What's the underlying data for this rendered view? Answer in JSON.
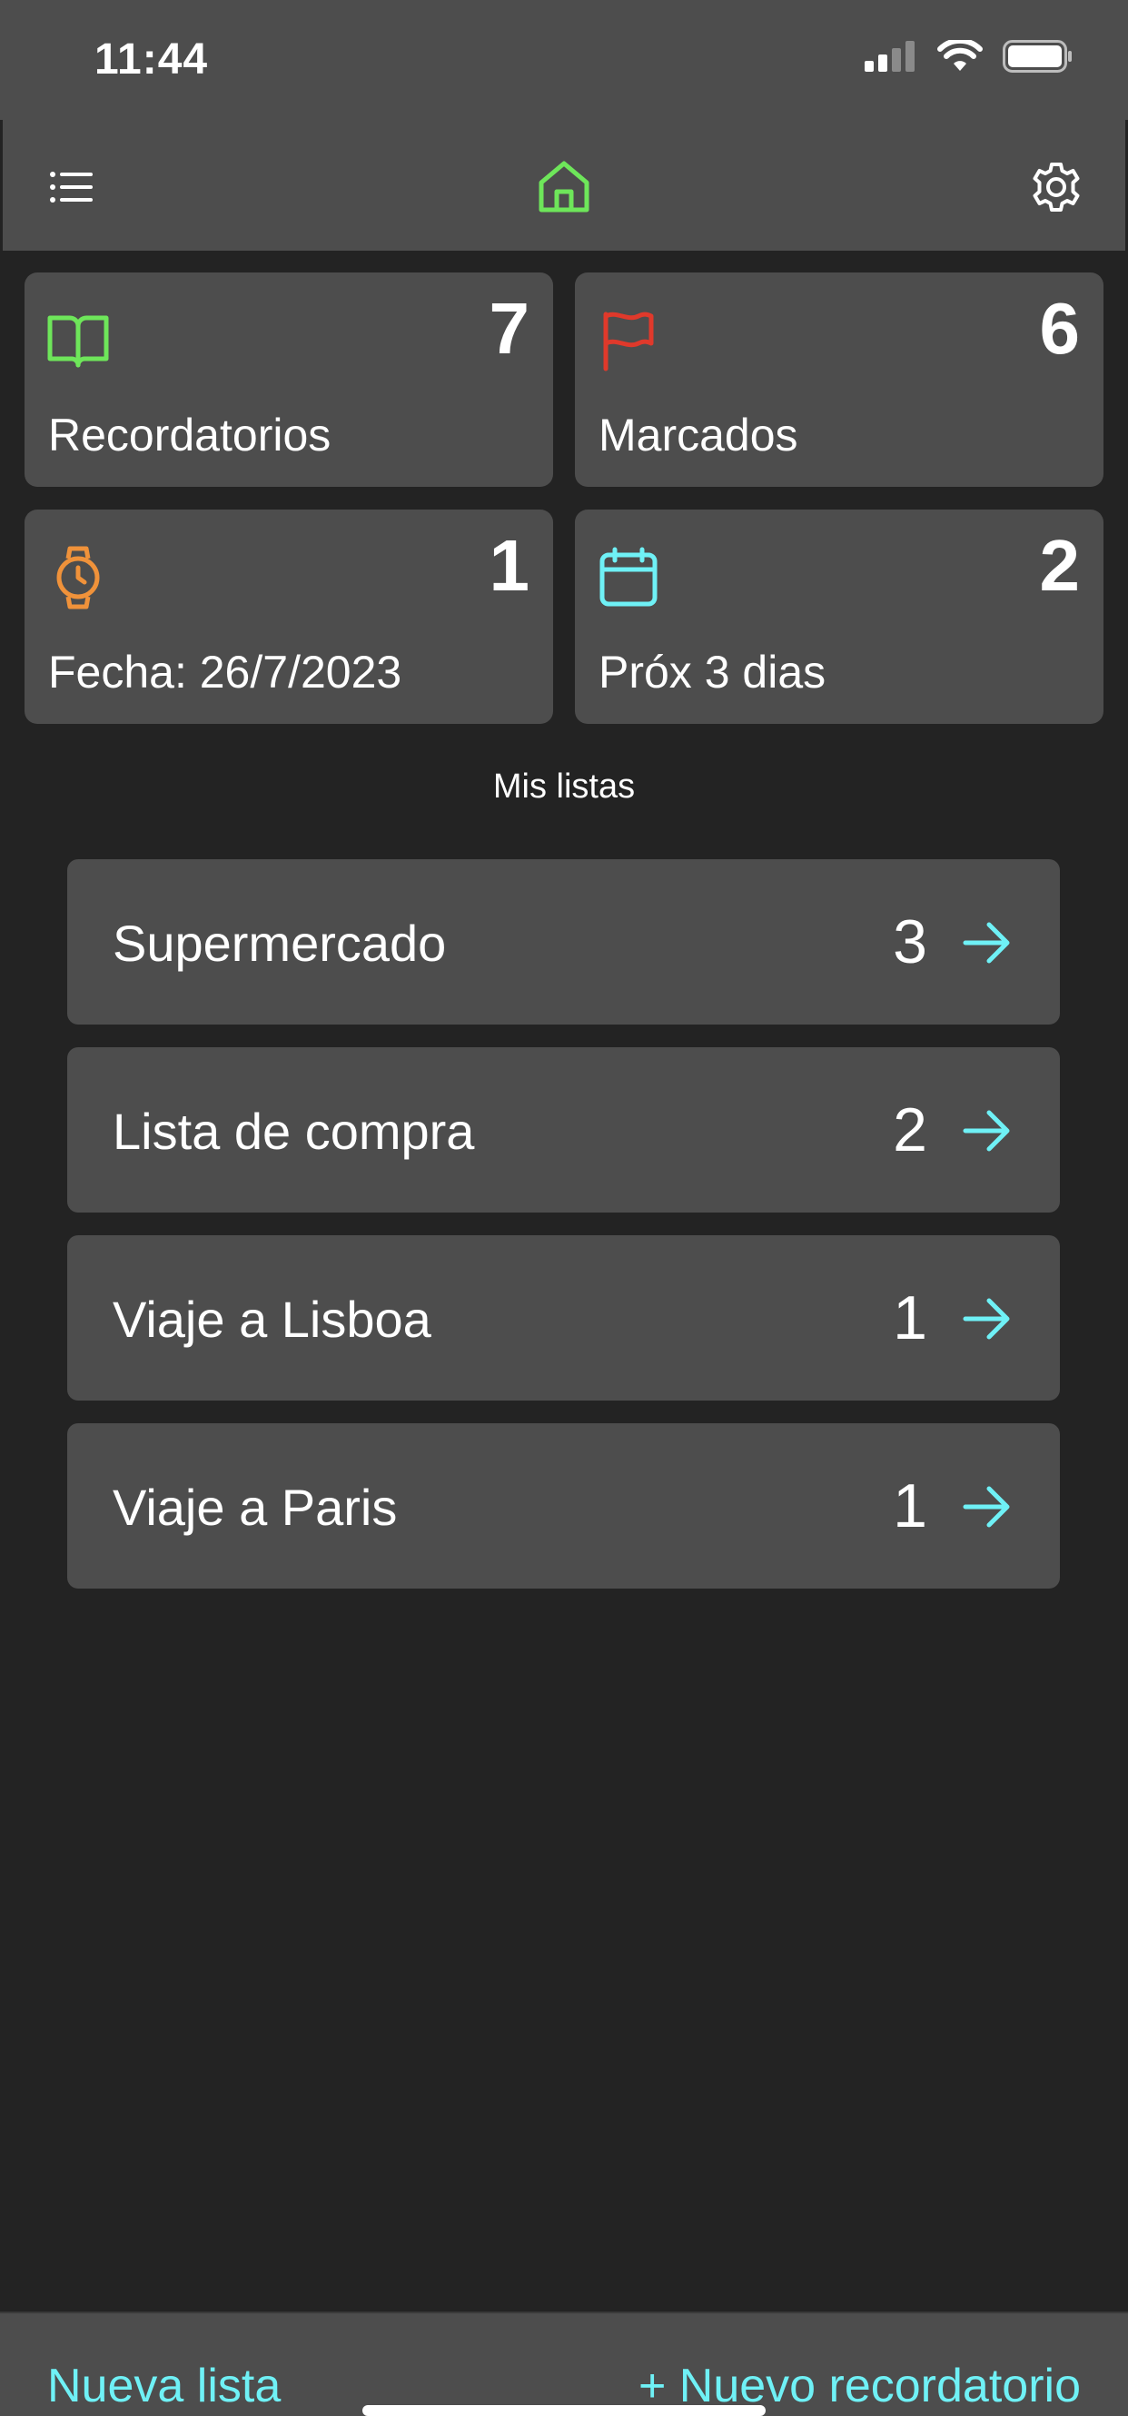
{
  "status": {
    "time": "11:44"
  },
  "nav": {
    "menu_icon": "list-icon",
    "home_icon": "home-icon",
    "settings_icon": "gear-icon"
  },
  "cards": [
    {
      "icon": "book-icon",
      "count": "7",
      "label": "Recordatorios",
      "color": "#6ee65a"
    },
    {
      "icon": "flag-icon",
      "count": "6",
      "label": "Marcados",
      "color": "#e0392b"
    },
    {
      "icon": "watch-icon",
      "count": "1",
      "label": "Fecha: 26/7/2023",
      "color": "#f0923a"
    },
    {
      "icon": "calendar-icon",
      "count": "2",
      "label": "Próx 3 dias",
      "color": "#6ff1f6"
    }
  ],
  "section_title": "Mis listas",
  "lists": [
    {
      "name": "Supermercado",
      "count": "3"
    },
    {
      "name": "Lista de compra",
      "count": "2"
    },
    {
      "name": "Viaje a Lisboa",
      "count": "1"
    },
    {
      "name": "Viaje a Paris",
      "count": "1"
    }
  ],
  "bottom": {
    "new_list": "Nueva lista",
    "new_reminder": "+ Nuevo recordatorio"
  },
  "colors": {
    "accent": "#6ff1f6",
    "home": "#6ee65a",
    "surface": "#4d4d4d",
    "background": "#232323"
  }
}
